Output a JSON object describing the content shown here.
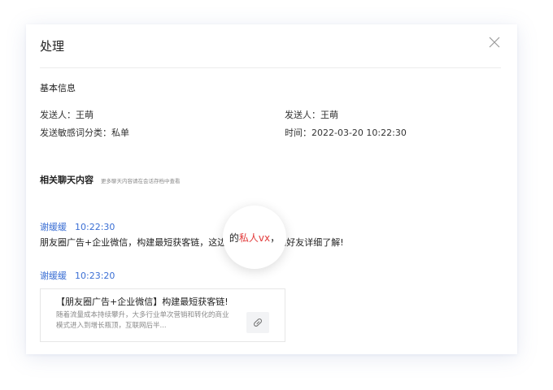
{
  "dialog": {
    "title": "处理",
    "close_icon": "close-icon"
  },
  "basic_info": {
    "section_title": "基本信息",
    "sender_left": "发送人：王萌",
    "sender_right": "发送人：王萌",
    "category": "发送敏感词分类：私单",
    "time": "时间：2022-03-20 10:22:30"
  },
  "chat": {
    "section_title": "相关聊天内容",
    "hint": "更多聊天内容请在会话存档中查看",
    "messages": [
      {
        "sender": "谢缓缓",
        "time": "10:22:30",
        "text_before": "朋友圈广告+企业微信，构建最短获客链，这边",
        "text_after": "追加好友详细了解!"
      },
      {
        "sender": "谢缓缓",
        "time": "10:23:20"
      }
    ],
    "magnifier": {
      "prefix": "的",
      "highlight": "私人vx",
      "suffix": "，",
      "highlight_color": "#e23b3b"
    },
    "card": {
      "title": "【朋友圈广告+企业微信】构建最短获客链!",
      "desc": "随着流量成本持续攀升，大多行业单次营销和转化的商业模式进入到增长瓶顶，互联网后半...",
      "icon": "link-icon"
    }
  },
  "colors": {
    "accent": "#3b6fd4",
    "sensitive": "#e23b3b"
  }
}
